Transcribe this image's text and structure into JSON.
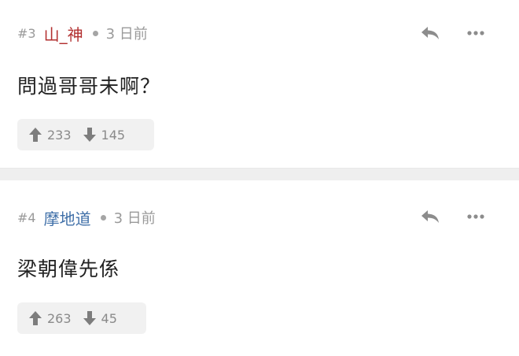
{
  "comments": [
    {
      "floor": "#3",
      "username": "山_神",
      "username_color": "#b22f2f",
      "time": "3 日前",
      "content": "問過哥哥未啊？",
      "upvotes": "233",
      "downvotes": "145"
    },
    {
      "floor": "#4",
      "username": "摩地道",
      "username_color": "#3f6fa8",
      "time": "3 日前",
      "content": "梁朝偉先係",
      "upvotes": "263",
      "downvotes": "45"
    }
  ],
  "icons": {
    "reply": "reply-icon",
    "more": "more-icon",
    "upvote": "arrow-up-icon",
    "downvote": "arrow-down-icon"
  }
}
